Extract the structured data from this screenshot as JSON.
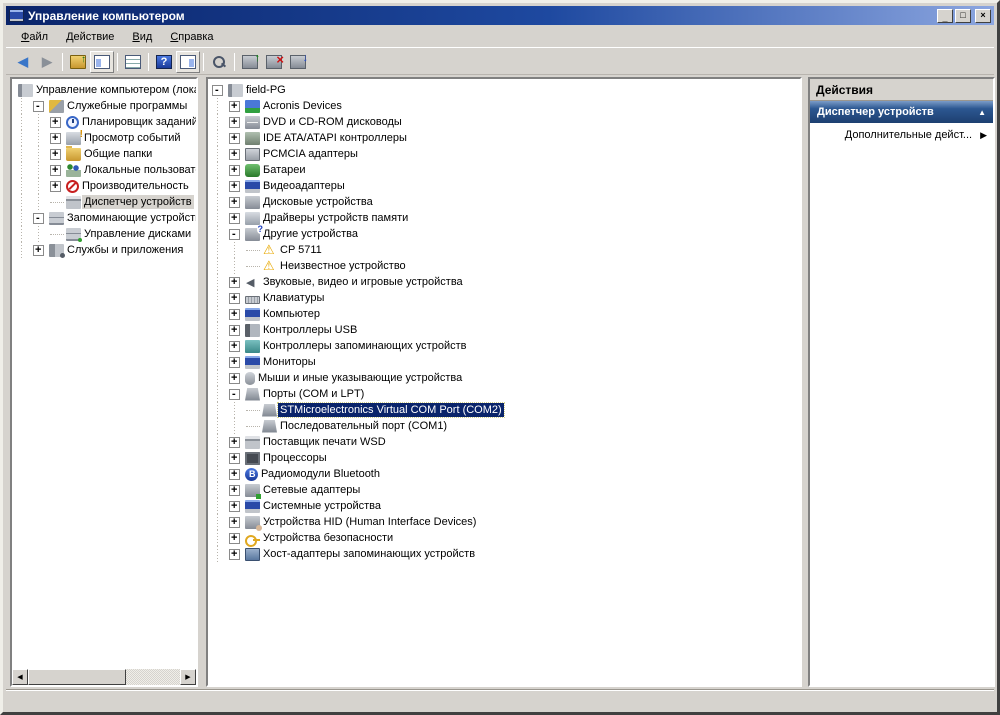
{
  "window": {
    "title": "Управление компьютером",
    "controls": {
      "minimize": "_",
      "maximize": "□",
      "close": "×"
    }
  },
  "menu_bar": {
    "items": [
      {
        "label": "Файл"
      },
      {
        "label": "Действие"
      },
      {
        "label": "Вид"
      },
      {
        "label": "Справка"
      }
    ]
  },
  "toolbar": {
    "buttons": [
      {
        "type": "button",
        "name": "back",
        "icon": "back-arrow"
      },
      {
        "type": "button",
        "name": "forward",
        "icon": "forward-arrow"
      },
      {
        "type": "separator"
      },
      {
        "type": "button",
        "name": "up-level",
        "icon": "folder-up"
      },
      {
        "type": "button",
        "name": "show-console-tree",
        "icon": "console-tree-pane",
        "latched": true
      },
      {
        "type": "separator"
      },
      {
        "type": "button",
        "name": "properties",
        "icon": "properties-doc"
      },
      {
        "type": "separator"
      },
      {
        "type": "button",
        "name": "help",
        "icon": "help-question"
      },
      {
        "type": "button",
        "name": "show-action-pane",
        "icon": "action-pane",
        "latched": true
      },
      {
        "type": "separator"
      },
      {
        "type": "button",
        "name": "scan-hardware",
        "icon": "magnifier-computer"
      },
      {
        "type": "separator"
      },
      {
        "type": "button",
        "name": "update-driver",
        "icon": "device-up-arrow"
      },
      {
        "type": "button",
        "name": "uninstall-device",
        "icon": "device-red-x"
      },
      {
        "type": "button",
        "name": "scan-changes",
        "icon": "device-down-arrow"
      }
    ],
    "glyphs": {
      "back": "◀",
      "forward": "▶",
      "help": "?"
    }
  },
  "console_tree": {
    "nodes": [
      {
        "label": "Управление компьютером (лока",
        "icon": "mgmt-computer",
        "depth": 0,
        "expander": "none"
      },
      {
        "label": "Служебные программы",
        "icon": "tools",
        "depth": 1,
        "expander": "minus"
      },
      {
        "label": "Планировщик заданий",
        "icon": "scheduler",
        "depth": 2,
        "expander": "plus"
      },
      {
        "label": "Просмотр событий",
        "icon": "event-viewer",
        "depth": 2,
        "expander": "plus"
      },
      {
        "label": "Общие папки",
        "icon": "shared-folders",
        "depth": 2,
        "expander": "plus"
      },
      {
        "label": "Локальные пользовател",
        "icon": "users",
        "depth": 2,
        "expander": "plus"
      },
      {
        "label": "Производительность",
        "icon": "performance",
        "depth": 2,
        "expander": "plus"
      },
      {
        "label": "Диспетчер устройств",
        "icon": "device-manager",
        "depth": 2,
        "expander": "none",
        "selected": "inactive"
      },
      {
        "label": "Запоминающие устройства",
        "icon": "storage",
        "depth": 1,
        "expander": "minus"
      },
      {
        "label": "Управление дисками",
        "icon": "disk-management",
        "depth": 2,
        "expander": "none"
      },
      {
        "label": "Службы и приложения",
        "icon": "services",
        "depth": 1,
        "expander": "plus"
      }
    ],
    "scrollbar": {
      "left_arrow": "◀",
      "right_arrow": "▶"
    }
  },
  "device_tree": {
    "nodes": [
      {
        "label": "field-PG",
        "icon": "computer",
        "depth": 0,
        "expander": "minus"
      },
      {
        "label": "Acronis Devices",
        "icon": "acronis-device",
        "depth": 1,
        "expander": "plus"
      },
      {
        "label": "DVD и CD-ROM дисководы",
        "icon": "dvd-drive",
        "depth": 1,
        "expander": "plus"
      },
      {
        "label": "IDE ATA/ATAPI контроллеры",
        "icon": "ide-controller",
        "depth": 1,
        "expander": "plus"
      },
      {
        "label": "PCMCIA адаптеры",
        "icon": "pcmcia",
        "depth": 1,
        "expander": "plus"
      },
      {
        "label": "Батареи",
        "icon": "battery",
        "depth": 1,
        "expander": "plus"
      },
      {
        "label": "Видеоадаптеры",
        "icon": "display-adapter",
        "depth": 1,
        "expander": "plus"
      },
      {
        "label": "Дисковые устройства",
        "icon": "disk-drive",
        "depth": 1,
        "expander": "plus"
      },
      {
        "label": "Драйверы устройств памяти",
        "icon": "memory-driver",
        "depth": 1,
        "expander": "plus"
      },
      {
        "label": "Другие устройства",
        "icon": "other-devices",
        "depth": 1,
        "expander": "minus"
      },
      {
        "label": "CP 5711",
        "icon": "unknown-warning",
        "depth": 2,
        "expander": "none"
      },
      {
        "label": "Неизвестное устройство",
        "icon": "unknown-warning",
        "depth": 2,
        "expander": "none"
      },
      {
        "label": "Звуковые, видео и игровые устройства",
        "icon": "audio",
        "depth": 1,
        "expander": "plus"
      },
      {
        "label": "Клавиатуры",
        "icon": "keyboard",
        "depth": 1,
        "expander": "plus"
      },
      {
        "label": "Компьютер",
        "icon": "computer-node",
        "depth": 1,
        "expander": "plus"
      },
      {
        "label": "Контроллеры USB",
        "icon": "usb",
        "depth": 1,
        "expander": "plus"
      },
      {
        "label": "Контроллеры запоминающих устройств",
        "icon": "storage-controller",
        "depth": 1,
        "expander": "plus"
      },
      {
        "label": "Мониторы",
        "icon": "monitor",
        "depth": 1,
        "expander": "plus"
      },
      {
        "label": "Мыши и иные указывающие устройства",
        "icon": "mouse",
        "depth": 1,
        "expander": "plus"
      },
      {
        "label": "Порты (COM и LPT)",
        "icon": "ports",
        "depth": 1,
        "expander": "minus"
      },
      {
        "label": "STMicroelectronics Virtual COM Port (COM2)",
        "icon": "serial-port",
        "depth": 2,
        "expander": "none",
        "selected": "active"
      },
      {
        "label": "Последовательный порт (COM1)",
        "icon": "serial-port",
        "depth": 2,
        "expander": "none"
      },
      {
        "label": "Поставщик печати WSD",
        "icon": "printer-wsd",
        "depth": 1,
        "expander": "plus"
      },
      {
        "label": "Процессоры",
        "icon": "processor",
        "depth": 1,
        "expander": "plus"
      },
      {
        "label": "Радиомодули Bluetooth",
        "icon": "bluetooth",
        "depth": 1,
        "expander": "plus"
      },
      {
        "label": "Сетевые адаптеры",
        "icon": "network-adapter",
        "depth": 1,
        "expander": "plus"
      },
      {
        "label": "Системные устройства",
        "icon": "system-devices",
        "depth": 1,
        "expander": "plus"
      },
      {
        "label": "Устройства HID (Human Interface Devices)",
        "icon": "hid",
        "depth": 1,
        "expander": "plus"
      },
      {
        "label": "Устройства безопасности",
        "icon": "security-key",
        "depth": 1,
        "expander": "plus"
      },
      {
        "label": "Хост-адаптеры запоминающих устройств",
        "icon": "host-adapter",
        "depth": 1,
        "expander": "plus"
      }
    ]
  },
  "actions_pane": {
    "header": "Действия",
    "section_title": "Диспетчер устройств",
    "collapse_glyph": "▲",
    "item_label": "Дополнительные дейст...",
    "item_arrow": "▶"
  },
  "colors": {
    "titlebar_start": "#0a246a",
    "titlebar_end": "#8ca6e0",
    "chrome": "#d6d3ce",
    "selection_active": "#0a246a",
    "selection_inactive": "#d6d3ce",
    "actions_section_bar": "#2c5791",
    "warning_icon": "#e8a800"
  }
}
